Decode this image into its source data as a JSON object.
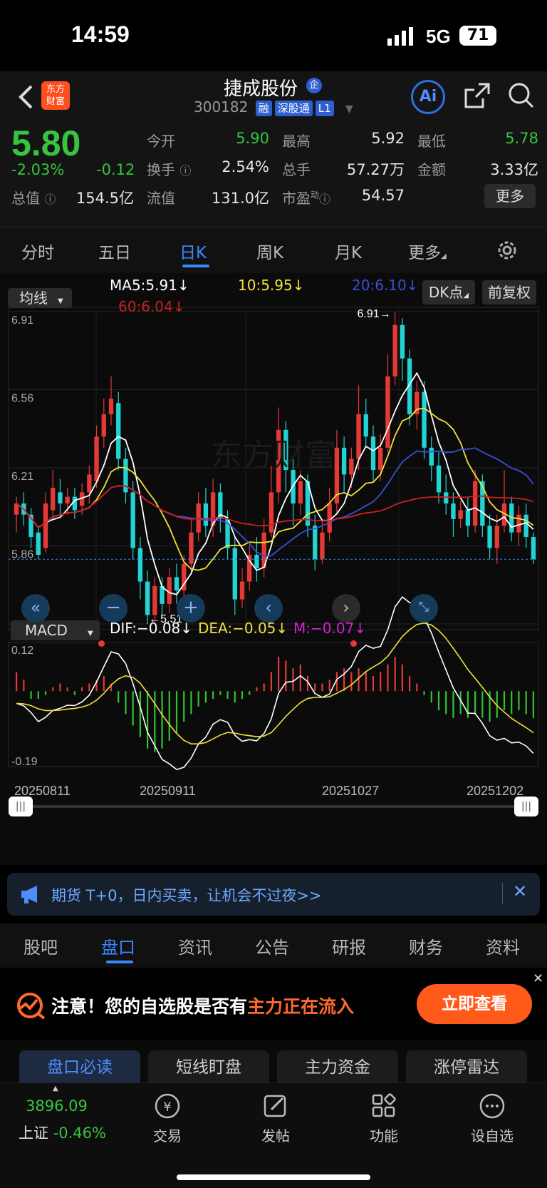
{
  "status": {
    "time": "14:59",
    "network": "5G",
    "battery": "71"
  },
  "header": {
    "logo_line1": "东方",
    "logo_line2": "财富",
    "title": "捷成股份",
    "badge": "企",
    "code": "300182",
    "tags": [
      "融",
      "深股通",
      "L1"
    ],
    "ai_label": "Ai"
  },
  "quote": {
    "price": "5.80",
    "change_pct": "-2.03%",
    "change_amt": "-0.12",
    "open_label": "今开",
    "open": "5.90",
    "high_label": "最高",
    "high": "5.92",
    "low_label": "最低",
    "low": "5.78",
    "turnover_label": "换手",
    "turnover": "2.54%",
    "volume_label": "总手",
    "volume": "57.27万",
    "amount_label": "金额",
    "amount": "3.33亿",
    "mktcap_label": "总值",
    "mktcap": "154.5亿",
    "float_label": "流值",
    "float": "131.0亿",
    "pe_label": "市盈",
    "pe_sup": "动",
    "pe": "54.57",
    "more_label": "更多"
  },
  "ktabs": [
    "分时",
    "五日",
    "日K",
    "周K",
    "月K",
    "更多"
  ],
  "active_ktab": "日K",
  "ma_bar": {
    "selector": "均线",
    "ma5": "MA5:5.91",
    "ma10": "10:5.95",
    "ma20": "20:6.10",
    "ma60": "60:6.04",
    "dk": "DK点",
    "fq": "前复权"
  },
  "chart_data": [
    {
      "type": "candlestick",
      "price_labels": [
        "6.91",
        "6.56",
        "6.21",
        "5.86",
        "5.51"
      ],
      "ylim": [
        5.51,
        6.91
      ],
      "high_marker": "6.91→",
      "low_marker": "←5.51",
      "current": 5.8,
      "series": [
        {
          "name": "MA5",
          "color": "#ffffff"
        },
        {
          "name": "MA10",
          "color": "#f2e13a"
        },
        {
          "name": "MA20",
          "color": "#3b4fd8"
        },
        {
          "name": "MA60",
          "color": "#d21f1f"
        }
      ],
      "x_labels": [
        "20250811",
        "20250911",
        "20251027",
        "20251202"
      ],
      "candles": [
        [
          6.0,
          6.05,
          6.08,
          5.92
        ],
        [
          6.05,
          6.0,
          6.1,
          5.95
        ],
        [
          6.0,
          5.9,
          6.03,
          5.85
        ],
        [
          5.92,
          5.82,
          5.95,
          5.8
        ],
        [
          5.85,
          6.05,
          6.1,
          5.83
        ],
        [
          6.02,
          6.12,
          6.2,
          5.98
        ],
        [
          6.1,
          6.05,
          6.16,
          6.0
        ],
        [
          6.05,
          6.08,
          6.12,
          6.0
        ],
        [
          6.08,
          6.02,
          6.12,
          5.98
        ],
        [
          6.04,
          6.1,
          6.14,
          6.0
        ],
        [
          6.1,
          6.18,
          6.22,
          6.05
        ],
        [
          6.15,
          6.35,
          6.4,
          6.12
        ],
        [
          6.35,
          6.45,
          6.52,
          6.3
        ],
        [
          6.45,
          6.52,
          6.62,
          6.4
        ],
        [
          6.5,
          6.25,
          6.55,
          6.2
        ],
        [
          6.25,
          6.1,
          6.3,
          6.05
        ],
        [
          6.1,
          5.85,
          6.15,
          5.8
        ],
        [
          5.85,
          5.7,
          5.9,
          5.62
        ],
        [
          5.7,
          5.55,
          5.75,
          5.51
        ],
        [
          5.55,
          5.68,
          5.72,
          5.52
        ],
        [
          5.68,
          5.6,
          5.72,
          5.55
        ],
        [
          5.6,
          5.72,
          5.76,
          5.56
        ],
        [
          5.72,
          5.66,
          5.78,
          5.6
        ],
        [
          5.66,
          5.78,
          5.82,
          5.62
        ],
        [
          5.78,
          5.92,
          5.98,
          5.74
        ],
        [
          5.92,
          6.05,
          6.1,
          5.88
        ],
        [
          6.05,
          5.95,
          6.12,
          5.9
        ],
        [
          5.95,
          6.1,
          6.16,
          5.9
        ],
        [
          6.1,
          5.98,
          6.14,
          5.92
        ],
        [
          5.98,
          5.85,
          6.02,
          5.8
        ],
        [
          5.85,
          5.62,
          5.9,
          5.55
        ],
        [
          5.62,
          5.7,
          5.76,
          5.58
        ],
        [
          5.7,
          5.82,
          5.86,
          5.66
        ],
        [
          5.82,
          5.76,
          5.9,
          5.7
        ],
        [
          5.76,
          5.92,
          5.98,
          5.72
        ],
        [
          5.92,
          6.1,
          6.22,
          5.9
        ],
        [
          6.1,
          6.38,
          6.48,
          6.05
        ],
        [
          6.38,
          6.2,
          6.42,
          6.1
        ],
        [
          6.2,
          6.05,
          6.25,
          5.95
        ],
        [
          6.05,
          6.15,
          6.2,
          6.0
        ],
        [
          6.15,
          5.95,
          6.18,
          5.9
        ],
        [
          5.95,
          5.8,
          6.0,
          5.75
        ],
        [
          5.8,
          5.92,
          5.98,
          5.78
        ],
        [
          5.92,
          6.05,
          6.12,
          5.88
        ],
        [
          6.05,
          6.3,
          6.38,
          6.0
        ],
        [
          6.3,
          6.18,
          6.35,
          6.1
        ],
        [
          6.18,
          6.25,
          6.3,
          6.12
        ],
        [
          6.25,
          6.45,
          6.58,
          6.2
        ],
        [
          6.45,
          6.35,
          6.52,
          6.3
        ],
        [
          6.35,
          6.2,
          6.4,
          6.15
        ],
        [
          6.2,
          6.3,
          6.36,
          6.15
        ],
        [
          6.3,
          6.62,
          6.72,
          6.28
        ],
        [
          6.62,
          6.85,
          6.91,
          6.58
        ],
        [
          6.85,
          6.7,
          6.88,
          6.6
        ],
        [
          6.7,
          6.45,
          6.74,
          6.4
        ],
        [
          6.45,
          6.55,
          6.6,
          6.38
        ],
        [
          6.55,
          6.3,
          6.6,
          6.25
        ],
        [
          6.3,
          6.22,
          6.35,
          6.15
        ],
        [
          6.22,
          6.1,
          6.28,
          6.05
        ],
        [
          6.1,
          6.05,
          6.18,
          6.0
        ],
        [
          6.05,
          5.98,
          6.1,
          5.9
        ],
        [
          5.98,
          6.02,
          6.06,
          5.94
        ],
        [
          6.02,
          5.95,
          6.08,
          5.9
        ],
        [
          5.95,
          6.15,
          6.2,
          5.92
        ],
        [
          6.15,
          5.95,
          6.18,
          5.9
        ],
        [
          5.95,
          5.85,
          6.0,
          5.8
        ],
        [
          5.85,
          5.95,
          6.0,
          5.78
        ],
        [
          5.95,
          6.05,
          6.2,
          5.92
        ],
        [
          6.05,
          5.92,
          6.08,
          5.88
        ],
        [
          5.92,
          6.0,
          6.04,
          5.86
        ],
        [
          6.0,
          5.9,
          6.05,
          5.85
        ],
        [
          5.9,
          5.8,
          5.92,
          5.78
        ]
      ]
    },
    {
      "type": "bar",
      "indicator": "MACD",
      "dif": "DIF:−0.08",
      "dea": "DEA:−0.05",
      "m": "M:−0.07",
      "ylim_labels": [
        "0.12",
        "-0.19"
      ],
      "ylim": [
        -0.19,
        0.12
      ],
      "m_values": [
        0.05,
        0.03,
        -0.02,
        -0.02,
        -0.01,
        0.01,
        0.02,
        0.01,
        -0.01,
        0.01,
        0.02,
        0.03,
        0.04,
        0.02,
        -0.03,
        -0.06,
        -0.09,
        -0.12,
        -0.15,
        -0.16,
        -0.15,
        -0.13,
        -0.11,
        -0.08,
        -0.06,
        -0.04,
        -0.03,
        -0.02,
        -0.01,
        -0.02,
        -0.03,
        -0.02,
        -0.01,
        0.01,
        0.02,
        0.05,
        0.09,
        0.08,
        0.06,
        0.07,
        0.04,
        0.02,
        0.02,
        0.03,
        0.05,
        0.06,
        0.05,
        0.06,
        0.05,
        0.04,
        0.05,
        0.07,
        0.09,
        0.07,
        0.04,
        0.02,
        -0.01,
        -0.03,
        -0.05,
        -0.06,
        -0.07,
        -0.06,
        -0.07,
        -0.06,
        -0.07,
        -0.08,
        -0.07,
        -0.05,
        -0.06,
        -0.05,
        -0.06,
        -0.07
      ]
    }
  ],
  "ad": {
    "text": "期货 T+0，日内买卖，让机会不过夜>>"
  },
  "btabs": [
    "股吧",
    "盘口",
    "资讯",
    "公告",
    "研报",
    "财务",
    "资料"
  ],
  "active_btab": "盘口",
  "banner": {
    "prefix": "注意！您的自选股是否有",
    "highlight": "主力正在流入",
    "button": "立即查看"
  },
  "subtabs": [
    "盘口必读",
    "短线盯盘",
    "主力资金",
    "涨停雷达"
  ],
  "active_subtab": "盘口必读",
  "bnav": {
    "index_value": "3896.09",
    "index_name": "上证",
    "index_change": "-0.46%",
    "items": [
      "交易",
      "发帖",
      "功能",
      "设自选"
    ]
  },
  "colors": {
    "up": "#e53935",
    "down": "#22d3d3",
    "accent": "#3a87ff",
    "gain_text": "#37c43e"
  }
}
